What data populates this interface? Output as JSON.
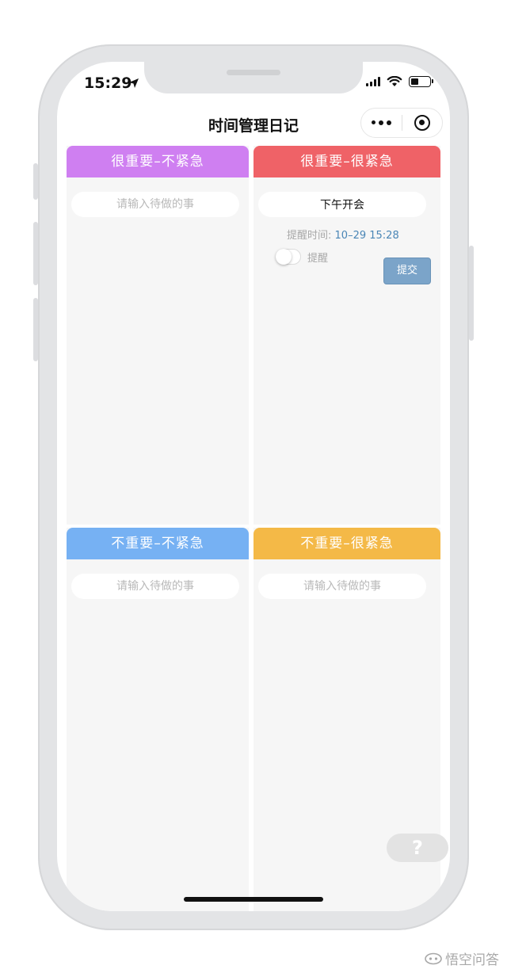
{
  "status_bar": {
    "time": "15:29"
  },
  "nav": {
    "title": "时间管理日记"
  },
  "quadrants": [
    {
      "title": "很重要–不紧急",
      "color": "#cf7ff1",
      "input_placeholder": "请输入待做的事",
      "input_value": ""
    },
    {
      "title": "很重要–很紧急",
      "color": "#ef6267",
      "input_placeholder": "请输入待做的事",
      "input_value": "下午开会",
      "remind_time_label": "提醒时间:",
      "remind_time_value": "10–29 15:28",
      "remind_toggle_label": "提醒",
      "remind_enabled": false,
      "submit_label": "提交"
    },
    {
      "title": "不重要–不紧急",
      "color": "#76b1f3",
      "input_placeholder": "请输入待做的事",
      "input_value": ""
    },
    {
      "title": "不重要–很紧急",
      "color": "#f4b947",
      "input_placeholder": "请输入待做的事",
      "input_value": ""
    }
  ],
  "help_label": "?",
  "watermark": "悟空问答",
  "icons": [
    "location-arrow-icon",
    "signal-icon",
    "wifi-icon",
    "battery-icon",
    "more-dots-icon",
    "target-icon",
    "help-icon",
    "wukong-logo-icon"
  ]
}
